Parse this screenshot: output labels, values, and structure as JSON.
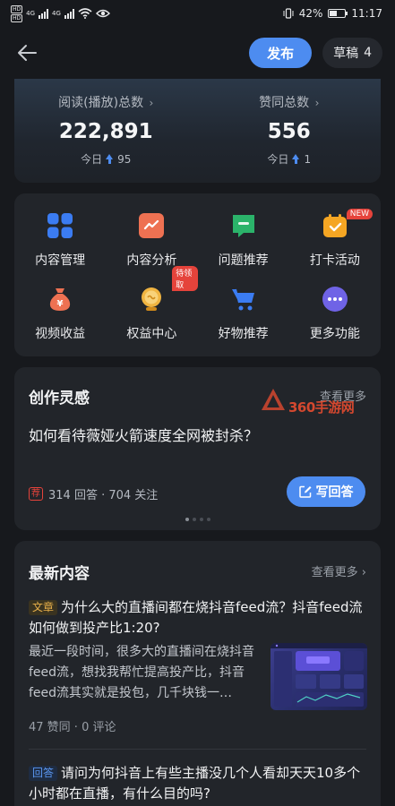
{
  "status_bar": {
    "sim1": "HD",
    "sim2": "HD",
    "net1": "4G",
    "net2": "4G",
    "battery": "42%",
    "battery_level": 0.42,
    "time": "11:17"
  },
  "header": {
    "publish_label": "发布",
    "draft_label": "草稿",
    "draft_count": "4"
  },
  "stats": {
    "reads_label": "阅读(播放)总数",
    "reads_value": "222,891",
    "reads_today_label": "今日",
    "reads_today": "95",
    "likes_label": "赞同总数",
    "likes_value": "556",
    "likes_today_label": "今日",
    "likes_today": "1",
    "arrow": "›"
  },
  "tools": {
    "items": [
      {
        "label": "内容管理",
        "icon": "grid-icon"
      },
      {
        "label": "内容分析",
        "icon": "chart-icon"
      },
      {
        "label": "问题推荐",
        "icon": "question-icon"
      },
      {
        "label": "打卡活动",
        "icon": "calendar-icon"
      },
      {
        "label": "视频收益",
        "icon": "money-bag-icon"
      },
      {
        "label": "权益中心",
        "icon": "medal-icon"
      },
      {
        "label": "好物推荐",
        "icon": "cart-icon"
      },
      {
        "label": "更多功能",
        "icon": "more-icon"
      }
    ],
    "badge_new": "NEW",
    "badge_wait": "待领取"
  },
  "inspiration": {
    "title": "创作灵感",
    "more": "查看更多",
    "watermark": "360手游网",
    "question": "如何看待薇娅火箭速度全网被封杀？",
    "hot_tag": "荐",
    "meta": "314 回答 · 704 关注",
    "write_label": "写回答"
  },
  "latest": {
    "title": "最新内容",
    "more": "查看更多 ›",
    "article1": {
      "tag": "文章",
      "title": "为什么大的直播间都在烧抖音feed流？抖音feed流如何做到投产比1:20?",
      "excerpt": "最近一段时间，很多大的直播间在烧抖音feed流，想找我帮忙提高投产比，抖音feed流其实就是投包，几千块钱一…",
      "meta": "47 赞同 · 0 评论"
    },
    "article2": {
      "tag": "回答",
      "title": "请问为何抖音上有些主播没几个人看却天天10多个小时都在直播，有什么目的吗?"
    }
  },
  "colors": {
    "accent": "#4d8cf0",
    "background": "#17191d",
    "card": "#22252a",
    "badge_red": "#e5433b"
  }
}
